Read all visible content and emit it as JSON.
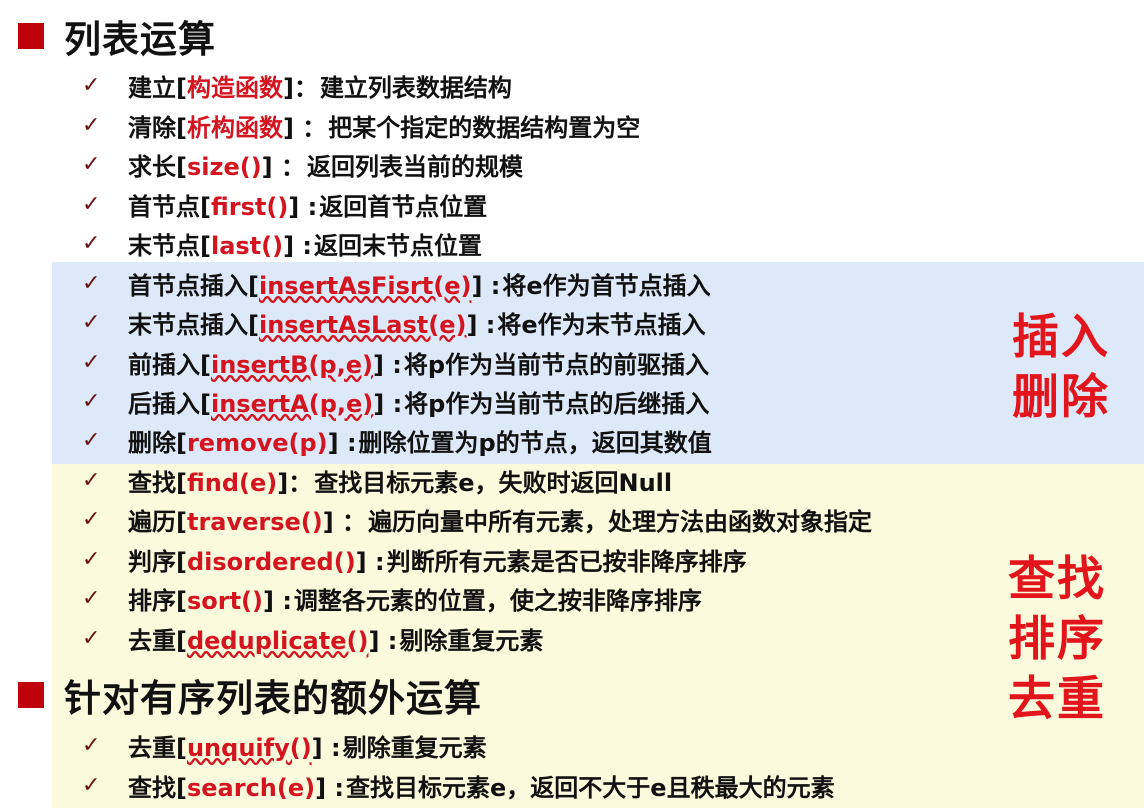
{
  "headings": {
    "list_ops": "列表运算",
    "sorted_ops": "针对有序列表的额外运算"
  },
  "items": [
    {
      "pre": "建立[",
      "fn": "构造函数",
      "post": "]：",
      "desc": "建立列表数据结构"
    },
    {
      "pre": "清除[",
      "fn": "析构函数",
      "post": "] ：",
      "desc": "把某个指定的数据结构置为空"
    },
    {
      "pre": "求长[",
      "fn": "size()",
      "post": "] ：",
      "desc": "返回列表当前的规模"
    },
    {
      "pre": "首节点[",
      "fn": "first()",
      "post": "] :",
      "desc": "返回首节点位置"
    },
    {
      "pre": "末节点[",
      "fn": "last()",
      "post": "] :",
      "desc": "返回末节点位置"
    },
    {
      "pre": "首节点插入[",
      "fn": "insertAsFisrt(e)",
      "post": "] :",
      "desc": "将e作为首节点插入"
    },
    {
      "pre": "末节点插入[",
      "fn": "insertAsLast(e)",
      "post": "] :",
      "desc": "将e作为末节点插入"
    },
    {
      "pre": "前插入[",
      "fn": "insertB(p,e)",
      "post": "] :",
      "desc": "将p作为当前节点的前驱插入"
    },
    {
      "pre": "后插入[",
      "fn": "insertA(p,e)",
      "post": "] :",
      "desc": "将p作为当前节点的后继插入"
    },
    {
      "pre": "删除[",
      "fn": "remove(p)",
      "post": "] :",
      "desc": "删除位置为p的节点，返回其数值"
    },
    {
      "pre": "查找[",
      "fn": "find(e)",
      "post": "]：",
      "desc": "查找目标元素e，失败时返回Null"
    },
    {
      "pre": "遍历[",
      "fn": "traverse()",
      "post": "] ：",
      "desc": "遍历向量中所有元素，处理方法由函数对象指定"
    },
    {
      "pre": "判序[",
      "fn": "disordered()",
      "post": "] :",
      "desc": "判断所有元素是否已按非降序排序"
    },
    {
      "pre": "排序[",
      "fn": "sort()",
      "post": "] :",
      "desc": "调整各元素的位置，使之按非降序排序"
    },
    {
      "pre": "去重[",
      "fn": "deduplicate()",
      "post": "] :",
      "desc": "剔除重复元素"
    },
    {
      "pre": "去重[",
      "fn": "unquify()",
      "post": "] :",
      "desc": "剔除重复元素"
    },
    {
      "pre": "查找[",
      "fn": "search(e)",
      "post": "] :",
      "desc": "查找目标元素e，返回不大于e且秩最大的元素"
    }
  ],
  "side_labels": {
    "insert": [
      "插入",
      "删除"
    ],
    "search": [
      "查找",
      "排序",
      "去重"
    ]
  },
  "check_glyph": "✓",
  "colors": {
    "accent_red": "#d4141f",
    "bullet": "#c0000b",
    "blue_band": "#dde9f8",
    "yellow_band": "#fcfadc"
  }
}
